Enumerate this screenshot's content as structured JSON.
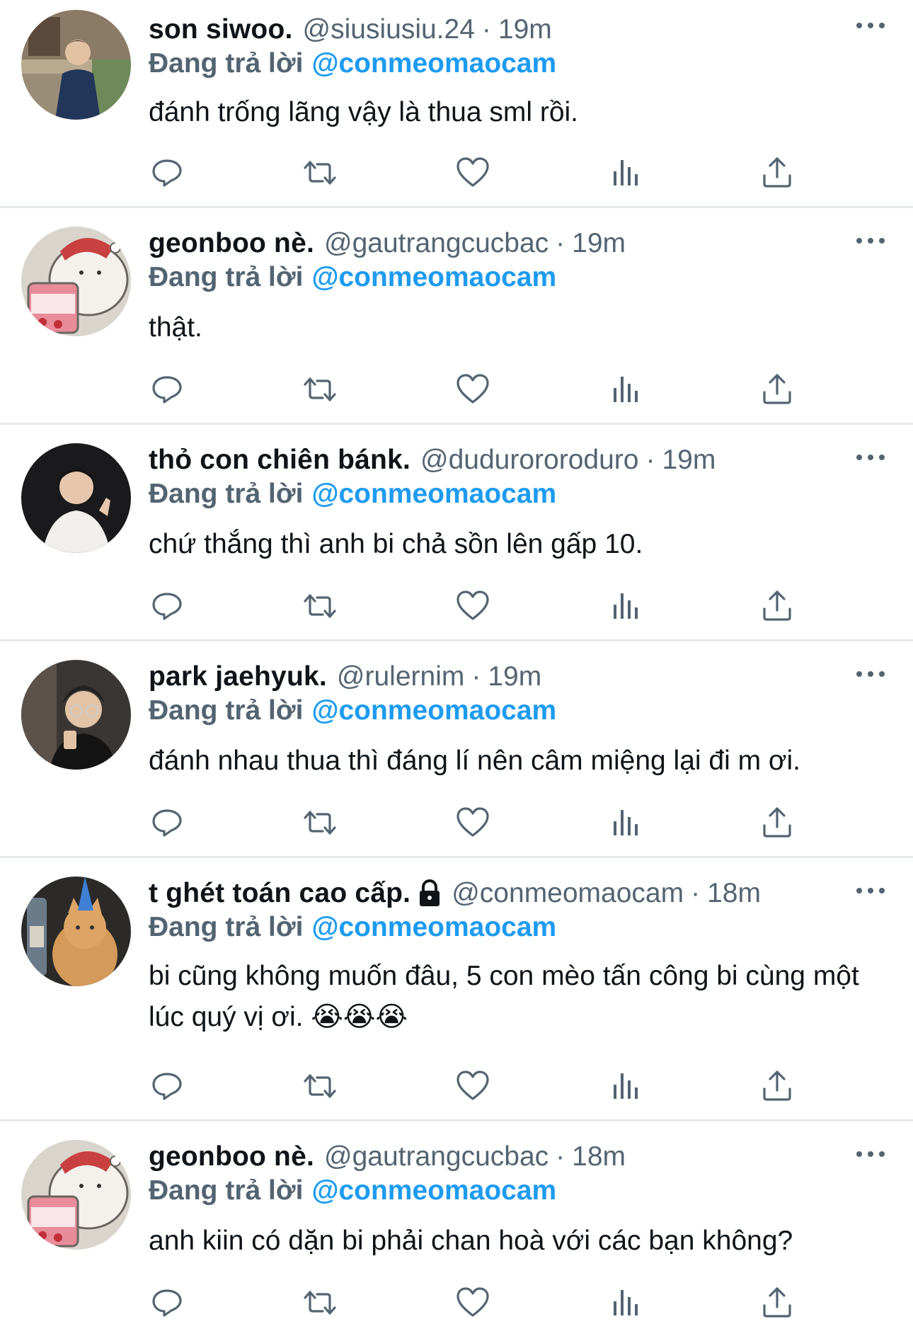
{
  "tweets": [
    {
      "name": "son siwoo.",
      "handle": "@siusiusiu.24",
      "separator": "·",
      "time": "19m",
      "replying_label": "Đang trả lời",
      "replying_to": "@conmeomaocam",
      "text": "đánh trống lãng vậy là thua sml rồi.",
      "avatar_icon": "avatar-photo-man-outdoor",
      "locked": false
    },
    {
      "name": "geonboo nè.",
      "handle": "@gautrangcucbac",
      "separator": "·",
      "time": "19m",
      "replying_label": "Đang trả lời",
      "replying_to": "@conmeomaocam",
      "text": "thật.",
      "avatar_icon": "avatar-bear-illustration",
      "locked": false
    },
    {
      "name": "thỏ con chiên bánk.",
      "handle": "@dudurororoduro",
      "separator": "·",
      "time": "19m",
      "replying_label": "Đang trả lời",
      "replying_to": "@conmeomaocam",
      "text": "chứ thắng thì anh bi chả sồn lên gấp 10.",
      "avatar_icon": "avatar-photo-man-dark",
      "locked": false
    },
    {
      "name": "park jaehyuk.",
      "handle": "@rulernim",
      "separator": "·",
      "time": "19m",
      "replying_label": "Đang trả lời",
      "replying_to": "@conmeomaocam",
      "text": "đánh nhau thua thì đáng lí nên câm miệng lại đi m ơi.",
      "avatar_icon": "avatar-photo-man-glasses",
      "locked": false
    },
    {
      "name": "t ghét toán cao cấp.",
      "handle": "@conmeomaocam",
      "separator": "·",
      "time": "18m",
      "replying_label": "Đang trả lời",
      "replying_to": "@conmeomaocam",
      "text": "bi cũng không muốn đâu, 5 con mèo tấn công bi cùng một lúc quý vị ơi. 😭😭😭",
      "avatar_icon": "avatar-photo-cat-party-hat",
      "locked": true
    },
    {
      "name": "geonboo nè.",
      "handle": "@gautrangcucbac",
      "separator": "·",
      "time": "18m",
      "replying_label": "Đang trả lời",
      "replying_to": "@conmeomaocam",
      "text": "anh kiin có dặn bi phải chan hoà với các bạn không?",
      "avatar_icon": "avatar-bear-illustration",
      "locked": false
    }
  ],
  "actions": [
    "reply-icon",
    "retweet-icon",
    "like-icon",
    "views-icon",
    "share-icon"
  ],
  "colors": {
    "link": "#1d9bf0",
    "secondary_text": "#536471",
    "icon": "#536471",
    "divider": "#e6e9ec"
  }
}
